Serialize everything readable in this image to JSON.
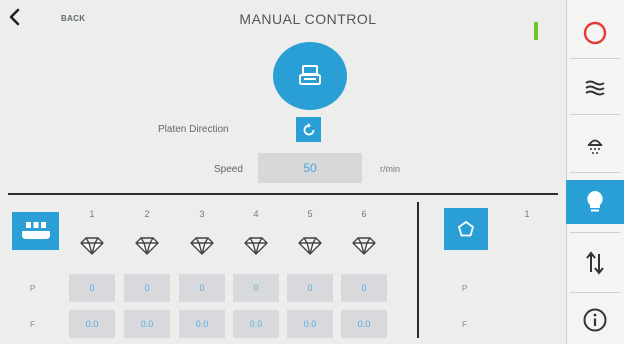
{
  "header": {
    "back_label": "BACK",
    "title": "MANUAL CONTROL"
  },
  "controls": {
    "platen_label": "Platen Direction",
    "speed_label": "Speed",
    "speed_value": "50",
    "speed_unit": "r/min"
  },
  "stations": {
    "columns": [
      "1",
      "2",
      "3",
      "4",
      "5",
      "6"
    ],
    "p_label": "P",
    "f_label": "F",
    "p_values": [
      "0",
      "0",
      "0",
      "0",
      "0",
      "0"
    ],
    "f_values": [
      "0.0",
      "0.0",
      "0.0",
      "0.0",
      "0.0",
      "0.0"
    ]
  },
  "group": {
    "column": "1",
    "p_label": "P",
    "f_label": "F"
  },
  "sidebar": {
    "items": [
      "power-icon",
      "waves-icon",
      "spray-icon",
      "bulb-icon",
      "sort-arrows-icon",
      "info-icon"
    ]
  },
  "colors": {
    "accent": "#2a9fd6",
    "status": "#6fc331",
    "power": "#e53935"
  }
}
